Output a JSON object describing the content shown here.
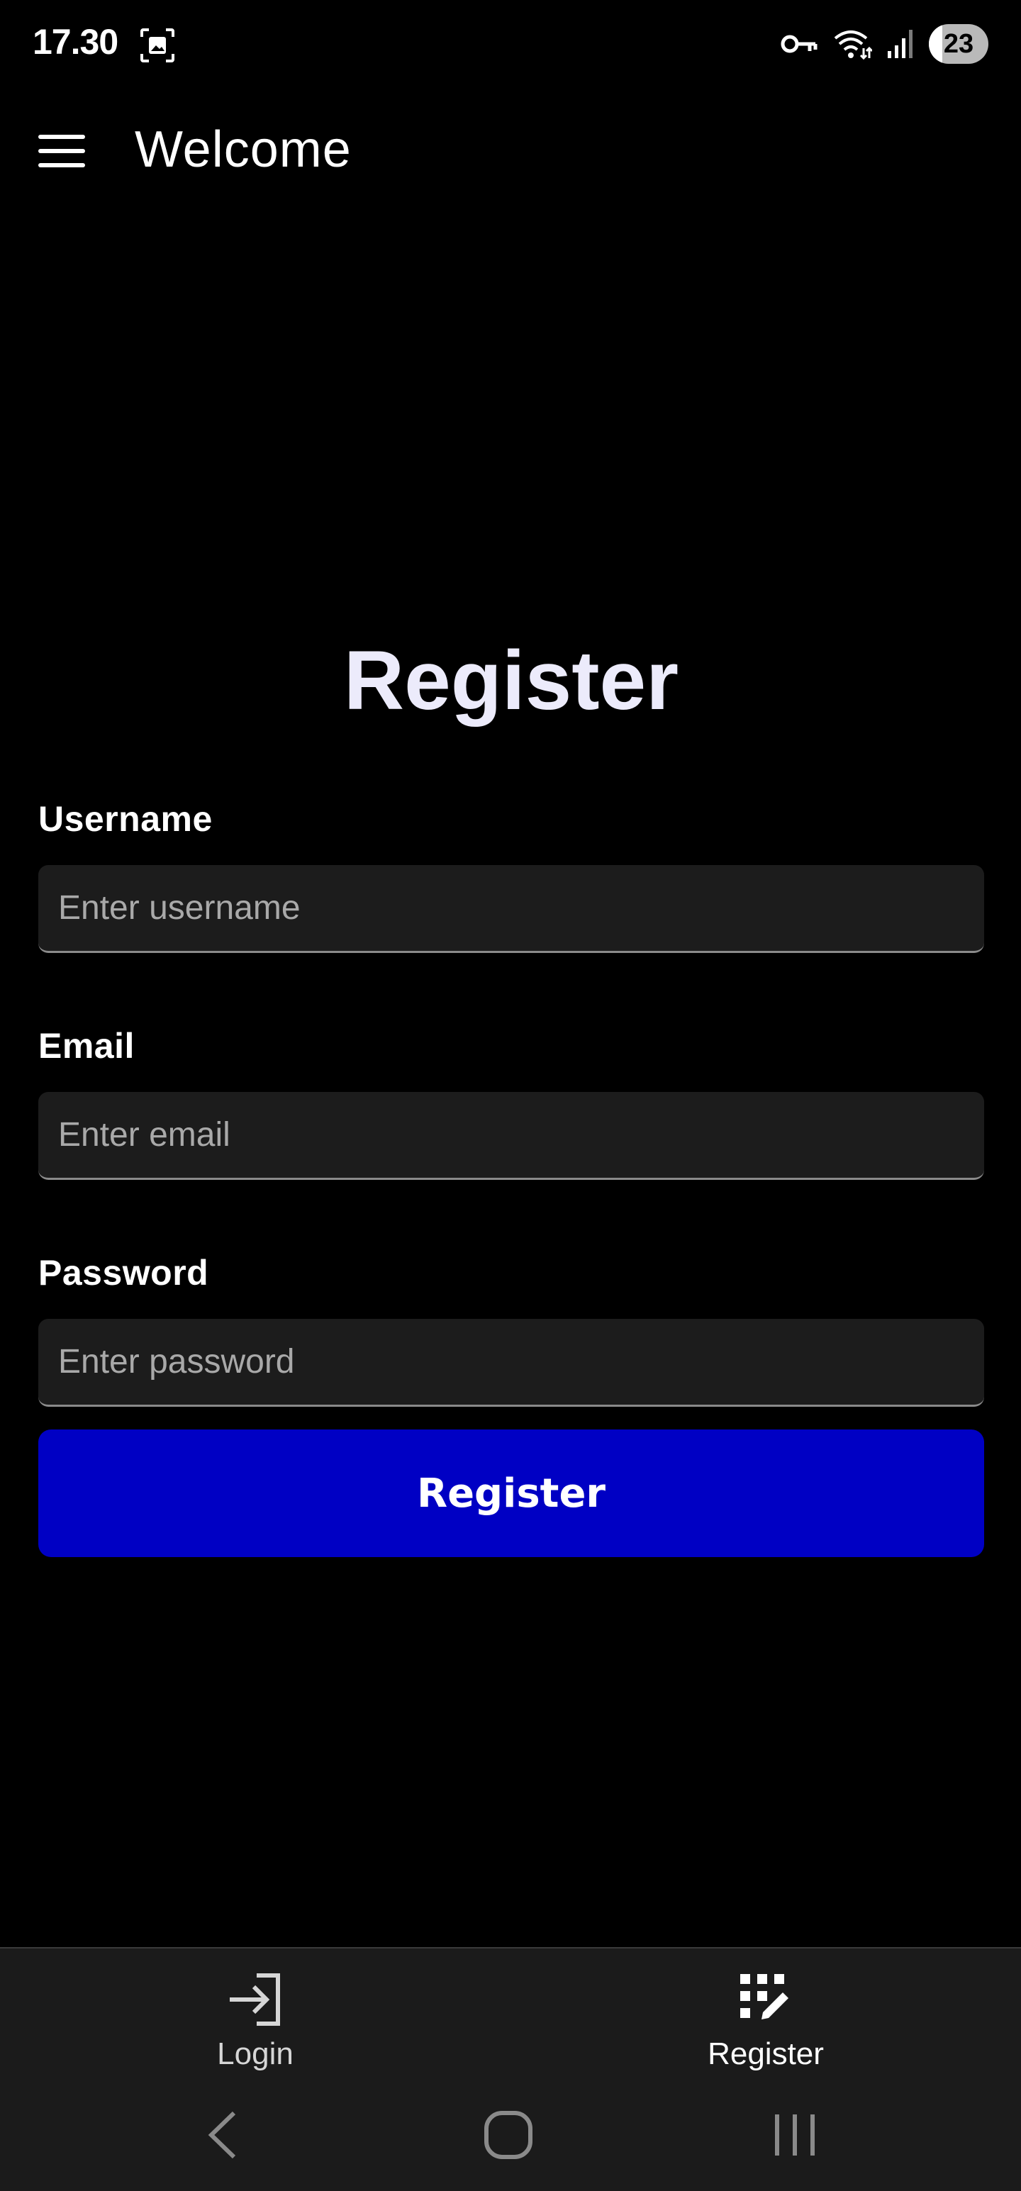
{
  "status_bar": {
    "time": "17.30",
    "battery": "23",
    "battery_level": 0.23,
    "icons": [
      "screenshot-icon",
      "vpn-key-icon",
      "wifi-icon",
      "signal-icon",
      "battery-icon"
    ]
  },
  "app_bar": {
    "title": "Welcome",
    "menu_icon": "hamburger-menu-icon"
  },
  "form": {
    "title": "Register",
    "username": {
      "label": "Username",
      "placeholder": "Enter username",
      "value": ""
    },
    "email": {
      "label": "Email",
      "placeholder": "Enter email",
      "value": ""
    },
    "password": {
      "label": "Password",
      "placeholder": "Enter password",
      "value": ""
    },
    "submit_label": "Register"
  },
  "bottom_nav": {
    "items": [
      {
        "label": "Login",
        "icon": "login-icon",
        "active": false
      },
      {
        "label": "Register",
        "icon": "register-icon",
        "active": true
      }
    ]
  },
  "system_nav": {
    "icons": [
      "back-icon",
      "home-icon",
      "recent-apps-icon"
    ]
  },
  "colors": {
    "background": "#000000",
    "input_background": "#1c1c1c",
    "button": "#0000c4",
    "nav_background": "#1b1b1b",
    "title_text": "#ecebfb"
  }
}
